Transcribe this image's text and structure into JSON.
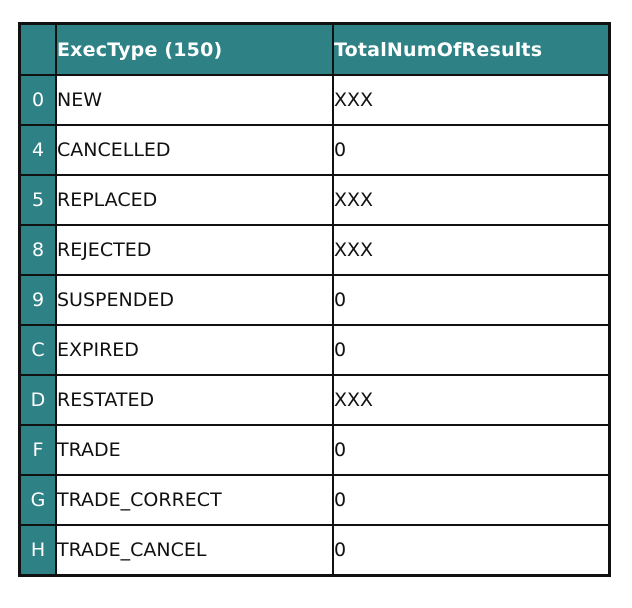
{
  "table": {
    "colors": {
      "header_bg": "#2e8185",
      "header_text": "#ffffff",
      "border": "#111111"
    },
    "headers": [
      "",
      "ExecType (150)",
      "TotalNumOfResults"
    ],
    "rows": [
      {
        "code": "0",
        "name": "NEW",
        "total": "XXX"
      },
      {
        "code": "4",
        "name": "CANCELLED",
        "total": "0"
      },
      {
        "code": "5",
        "name": "REPLACED",
        "total": "XXX"
      },
      {
        "code": "8",
        "name": "REJECTED",
        "total": "XXX"
      },
      {
        "code": "9",
        "name": "SUSPENDED",
        "total": "0"
      },
      {
        "code": "C",
        "name": "EXPIRED",
        "total": "0"
      },
      {
        "code": "D",
        "name": "RESTATED",
        "total": "XXX"
      },
      {
        "code": "F",
        "name": "TRADE",
        "total": "0"
      },
      {
        "code": "G",
        "name": "TRADE_CORRECT",
        "total": "0"
      },
      {
        "code": "H",
        "name": "TRADE_CANCEL",
        "total": "0"
      }
    ]
  }
}
